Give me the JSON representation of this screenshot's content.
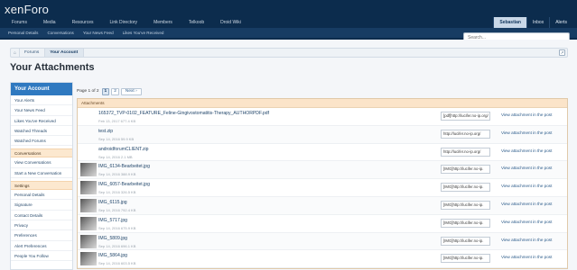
{
  "header": {
    "logo": {
      "prefix": "xen",
      "suffix": "Foro"
    },
    "tabs": [
      "Forums",
      "Media",
      "Resources",
      "Link Directory",
      "Members",
      "Telkoob",
      "Droid Wiki"
    ],
    "user_tabs": [
      {
        "label": "Sebastian",
        "selected": true
      },
      {
        "label": "Inbox",
        "selected": false
      },
      {
        "label": "Alerts",
        "selected": false
      }
    ],
    "subnav": [
      "Personal Details",
      "Conversations",
      "Your News Feed",
      "Likes You've Received"
    ],
    "search": {
      "placeholder": "Search..."
    }
  },
  "breadcrumb": [
    "Forums",
    "Your Account"
  ],
  "page_title": "Your Attachments",
  "sidebar": {
    "heading": "Your Account",
    "groups": [
      {
        "title": null,
        "items": [
          "Your Alerts",
          "Your News Feed",
          "Likes You've Received",
          "Watched Threads",
          "Watched Forums"
        ]
      },
      {
        "title": "Conversations",
        "items": [
          "View Conversations",
          "Start a New Conversation"
        ]
      },
      {
        "title": "Settings",
        "items": [
          "Personal Details",
          "Signature",
          "Contact Details",
          "Privacy",
          "Preferences",
          "Alert Preferences",
          "People You Follow"
        ]
      }
    ]
  },
  "pagenav": {
    "label": "Page 1 of 2",
    "pages": [
      "1",
      "2"
    ],
    "current": "1",
    "next": "Next ›"
  },
  "attachments": {
    "heading": "Attachments",
    "view_label": "View attachment in the post",
    "items": [
      {
        "name": "165372_TVP-0102_FEATURE_Feline-Gingivostomatitis-Therapy_AUTHORPDF.pdf",
        "meta": "Feb 13, 2017  677.4 KB",
        "code": "[pdf]http://lucifer.no-ip.org/",
        "thumb": "blank"
      },
      {
        "name": "test.zip",
        "meta": "Sep 14, 2016  59.9 KB",
        "code": "http://lucifer.no-ip.org/",
        "thumb": "blank"
      },
      {
        "name": "androidforumCLIENT.zip",
        "meta": "Sep 14, 2016  2.1 MB",
        "code": "http://lucifer.no-ip.org/",
        "thumb": "blank"
      },
      {
        "name": "IMG_6134-Bearbeitet.jpg",
        "meta": "Sep 14, 2016  388.9 KB",
        "code": "[IMG]http://lucifer.no-ip.",
        "thumb": "image"
      },
      {
        "name": "IMG_6057-Bearbeitet.jpg",
        "meta": "Sep 14, 2016  326.5 KB",
        "code": "[IMG]http://lucifer.no-ip.",
        "thumb": "image"
      },
      {
        "name": "IMG_6115.jpg",
        "meta": "Sep 14, 2016  792.4 KB",
        "code": "[IMG]http://lucifer.no-ip.",
        "thumb": "image"
      },
      {
        "name": "IMG_5717.jpg",
        "meta": "Sep 14, 2016  675.9 KB",
        "code": "[IMG]http://lucifer.no-ip.",
        "thumb": "image"
      },
      {
        "name": "IMG_5809.jpg",
        "meta": "Sep 14, 2016  696.1 KB",
        "code": "[IMG]http://lucifer.no-ip.",
        "thumb": "image"
      },
      {
        "name": "IMG_5864.jpg",
        "meta": "Sep 14, 2016  603.5 KB",
        "code": "[IMG]http://lucifer.no-ip.",
        "thumb": "image"
      }
    ]
  },
  "colors": {
    "header": "#0c2c4d",
    "accent": "#2f79c0",
    "section": "#fce8cf"
  }
}
